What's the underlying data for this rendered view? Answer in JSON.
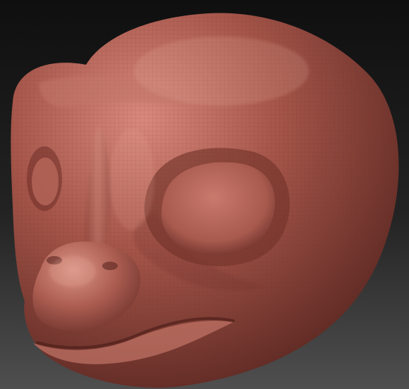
{
  "viewport": {
    "background_gradient_top": "#0f0f0f",
    "background_gradient_bottom": "#4f4f4f",
    "model_name": "sculpted-creature-head",
    "model_material_base": "#a55549",
    "model_material_highlight": "#d98a7d",
    "model_material_shadow": "#5b2822",
    "wire_grid_color": "#6c2f29"
  }
}
